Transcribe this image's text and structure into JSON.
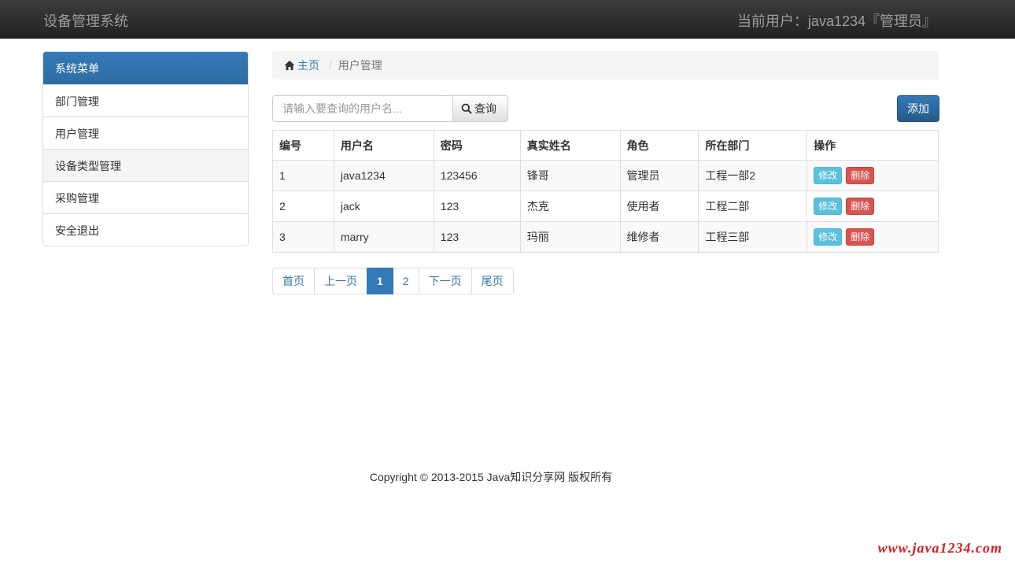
{
  "navbar": {
    "brand": "设备管理系统",
    "current_user": "当前用户：java1234『管理员』"
  },
  "sidebar": {
    "heading": "系统菜单",
    "items": [
      {
        "label": "部门管理"
      },
      {
        "label": "用户管理"
      },
      {
        "label": "设备类型管理"
      },
      {
        "label": "采购管理"
      },
      {
        "label": "安全退出"
      }
    ]
  },
  "breadcrumb": {
    "home": "主页",
    "separator": "/",
    "current": "用户管理"
  },
  "search": {
    "placeholder": "请输入要查询的用户名...",
    "value": "",
    "button_label": "查询"
  },
  "toolbar": {
    "add_label": "添加"
  },
  "table": {
    "columns": [
      "编号",
      "用户名",
      "密码",
      "真实姓名",
      "角色",
      "所在部门",
      "操作"
    ],
    "rows": [
      {
        "id": "1",
        "username": "java1234",
        "password": "123456",
        "real_name": "锋哥",
        "role": "管理员",
        "department": "工程一部2"
      },
      {
        "id": "2",
        "username": "jack",
        "password": "123",
        "real_name": "杰克",
        "role": "使用者",
        "department": "工程二部"
      },
      {
        "id": "3",
        "username": "marry",
        "password": "123",
        "real_name": "玛丽",
        "role": "维修者",
        "department": "工程三部"
      }
    ],
    "edit_label": "修改",
    "delete_label": "删除"
  },
  "pagination": {
    "first": "首页",
    "prev": "上一页",
    "pages": [
      "1",
      "2"
    ],
    "next": "下一页",
    "last": "尾页"
  },
  "footer": {
    "copyright": "Copyright © 2013-2015 Java知识分享网 版权所有"
  },
  "watermark": "www.java1234.com",
  "icons": {
    "home": "home-icon",
    "search": "search-icon"
  },
  "colors": {
    "primary": "#337ab7",
    "info": "#5bc0de",
    "danger": "#d9534f",
    "navbar": "#222222",
    "watermark": "#e21a1a"
  }
}
